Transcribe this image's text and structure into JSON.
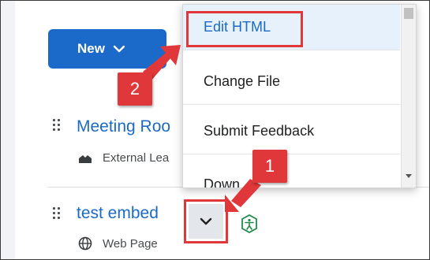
{
  "toolbar": {
    "new_label": "New"
  },
  "content_items": [
    {
      "title": "Meeting Roo",
      "subtitle": "External Lea",
      "icon": "external-learning-icon"
    },
    {
      "title": "test embed",
      "subtitle": "Web Page",
      "icon": "globe-icon"
    }
  ],
  "context_menu": {
    "items": [
      "Edit HTML",
      "Change File",
      "Submit Feedback",
      "Down"
    ],
    "active_index": 0
  },
  "annotations": {
    "step1": "1",
    "step2": "2",
    "color": "#e0383a"
  },
  "colors": {
    "accent": "#1b6ac9",
    "link": "#1a6ac6",
    "accessibility_icon": "#1f8a4c"
  }
}
